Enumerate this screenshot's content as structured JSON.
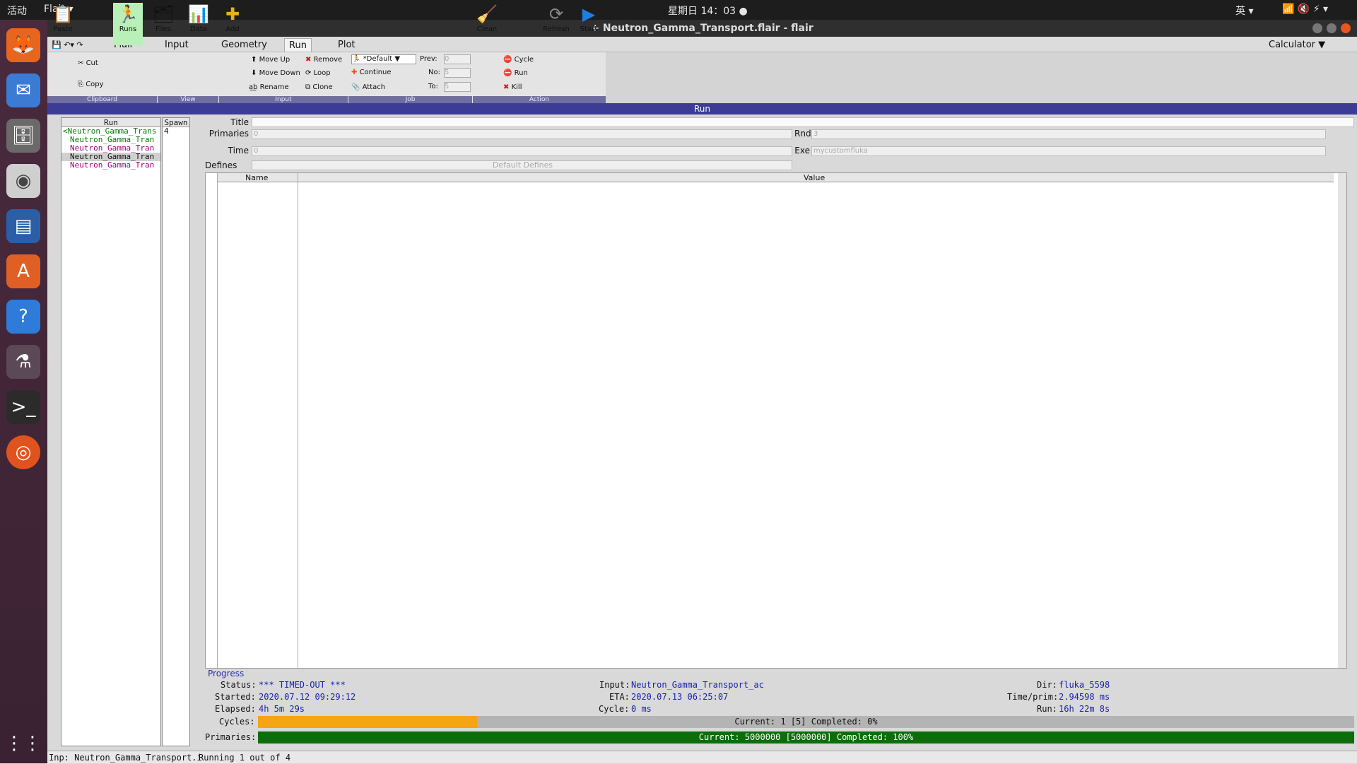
{
  "topbar": {
    "activities": "活动",
    "app": "Flair ▾",
    "clock": "星期日 14：03 ●",
    "ime": "英 ▾",
    "icons": "📶 🔇 ⚡ ▾"
  },
  "window": {
    "title": "+ Neutron_Gamma_Transport.flair - flair"
  },
  "tabs": {
    "flair": "Flair",
    "input": "Input",
    "geometry": "Geometry",
    "run": "Run",
    "plot": "Plot",
    "calculator": "Calculator ▼"
  },
  "ribbon": {
    "paste": "Paste",
    "cut": "Cut",
    "copy": "Copy",
    "runs": "Runs",
    "files": "Files",
    "data": "Data",
    "add": "Add",
    "move_up": "Move Up",
    "move_down": "Move Down",
    "rename": "Rename",
    "remove": "Remove",
    "loop": "Loop",
    "clone": "Clone",
    "default": "*Default",
    "cont": "Continue",
    "attach": "Attach",
    "prev": "Prev:",
    "no": "No:",
    "to": "To:",
    "prev_v": "0",
    "no_v": "5",
    "to_v": "5",
    "clean": "Clean",
    "cycle": "Cycle",
    "run": "Run",
    "kill": "Kill",
    "refresh": "Refresh",
    "start": "Start",
    "g_clip": "Clipboard",
    "g_view": "View",
    "g_input": "Input",
    "g_job": "Job",
    "g_action": "Action"
  },
  "runbar": "Run",
  "tree": {
    "col_run": "Run",
    "col_spawn": "Spawn",
    "items": [
      "<Neutron_Gamma_Trans",
      "Neutron_Gamma_Tran",
      "Neutron_Gamma_Tran",
      "Neutron_Gamma_Tran",
      "Neutron_Gamma_Tran"
    ],
    "spawn0": "4"
  },
  "form": {
    "title": "Title",
    "primaries": "Primaries",
    "primaries_v": "0",
    "rnd": "Rnd",
    "rnd_v": "3",
    "time": "Time",
    "time_v": "0",
    "exe": "Exe",
    "exe_v": "mycustomfluka",
    "defines": "Defines",
    "default_defines": "Default Defines",
    "col_name": "Name",
    "col_value": "Value"
  },
  "progress": {
    "legend": "Progress",
    "status_l": "Status:",
    "status_v": "*** TIMED-OUT ***",
    "started_l": "Started:",
    "started_v": "2020.07.12 09:29:12",
    "elapsed_l": "Elapsed:",
    "elapsed_v": "4h 5m 29s",
    "input_l": "Input:",
    "input_v": "Neutron_Gamma_Transport_ac",
    "eta_l": "ETA:",
    "eta_v": "2020.07.13 06:25:07",
    "cycle_l": "Cycle:",
    "cycle_v": "0 ms",
    "dir_l": "Dir:",
    "dir_v": "fluka_5598",
    "tpp_l": "Time/prim:",
    "tpp_v": "2.94598 ms",
    "run_l": "Run:",
    "run_v": "16h 22m 8s",
    "cycles_l": "Cycles:",
    "cycles_text": "Current: 1 [5]  Completed: 0%",
    "cycles_frac": 0.2,
    "prim_l": "Primaries:",
    "prim_text": "Current: 5000000 [5000000]  Completed: 100%",
    "prim_frac": 1.0
  },
  "statusbar": {
    "left": "Inp: Neutron_Gamma_Transport.i",
    "msg": "Running 1 out of 4"
  }
}
